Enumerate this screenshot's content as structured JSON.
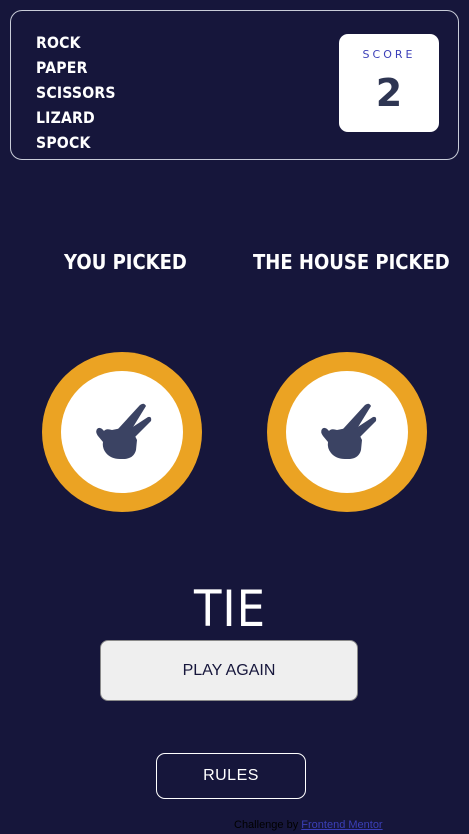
{
  "header": {
    "titles": [
      "ROCK",
      "PAPER",
      "SCISSORS",
      "LIZARD",
      "SPOCK"
    ],
    "score_label": "SCORE",
    "score_value": "2"
  },
  "game": {
    "you_picked_label": "YOU PICKED",
    "house_picked_label": "THE HOUSE PICKED",
    "you_choice": {
      "icon": "scissors-hand-icon",
      "ring_color": "#eba323"
    },
    "house_choice": {
      "icon": "scissors-hand-icon",
      "ring_color": "#eba323"
    },
    "result": "TIE",
    "play_again_label": "PLAY AGAIN"
  },
  "rules_label": "RULES",
  "attribution": {
    "prefix": "Challenge by",
    "link_text": "Frontend Mentor"
  },
  "colors": {
    "background": "#16163b",
    "hand": "#3b4363",
    "score_text": "#2e3552",
    "score_label": "#3b3fb8"
  }
}
